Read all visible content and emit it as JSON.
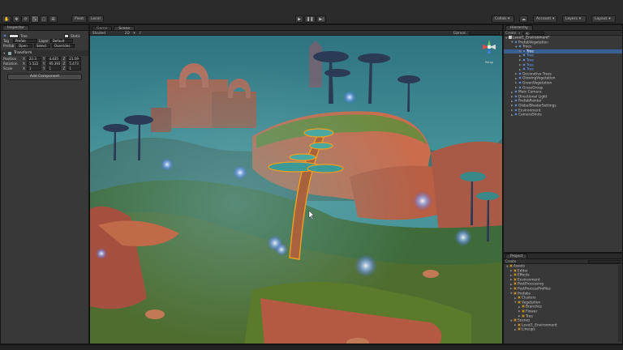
{
  "toolbar": {
    "pivot": "Pivot",
    "local": "Local",
    "collab": "Collab",
    "account": "Account",
    "layers": "Layers",
    "layout": "Layout"
  },
  "inspector": {
    "tab": "Inspector",
    "object_name": "Tree",
    "static": "Static",
    "tag_label": "Tag",
    "tag_value": "Prefab",
    "layer_label": "Layer",
    "layer_value": "Default",
    "prefab_label": "Prefab",
    "prefab_open": "Open",
    "prefab_select": "Select",
    "prefab_overrides": "Overrides",
    "transform_title": "Transform",
    "position_label": "Position",
    "position": {
      "x": "22.3",
      "y": "4.435",
      "z": "21.59"
    },
    "rotation_label": "Rotation",
    "rotation": {
      "x": "1.522",
      "y": "95.393",
      "z": "5.473"
    },
    "scale_label": "Scale",
    "scale": {
      "x": "1",
      "y": "1",
      "z": "1"
    },
    "add_component": "Add Component"
  },
  "scene_view": {
    "tab_game": "Game",
    "tab_scene": "Scene",
    "shaded": "Shaded",
    "mode_2d": "2D",
    "gizmos": "Gizmos",
    "persp": "Persp"
  },
  "hierarchy": {
    "tab": "Hierarchy",
    "create": "Create",
    "search_all": "All",
    "root": "Level1_Environment*",
    "items": [
      {
        "label": "PrefabVegetation",
        "depth": 1,
        "open": true
      },
      {
        "label": "Trees",
        "depth": 2,
        "open": true
      },
      {
        "label": "Tree",
        "depth": 3,
        "selected": true
      },
      {
        "label": "Tree",
        "depth": 3,
        "blue": true
      },
      {
        "label": "Tree",
        "depth": 3,
        "blue": true
      },
      {
        "label": "Tree",
        "depth": 3,
        "blue": true
      },
      {
        "label": "Tree",
        "depth": 3,
        "blue": true
      },
      {
        "label": "Decorative Trees",
        "depth": 2
      },
      {
        "label": "GlowingVegetation",
        "depth": 2
      },
      {
        "label": "GreenVegetation",
        "depth": 2
      },
      {
        "label": "GrassGroup",
        "depth": 2
      },
      {
        "label": "Main Camera",
        "depth": 1
      },
      {
        "label": "Directional Light",
        "depth": 1
      },
      {
        "label": "PrefabPainter",
        "depth": 1
      },
      {
        "label": "GlobalShaderSettings",
        "depth": 1
      },
      {
        "label": "Environment",
        "depth": 1
      },
      {
        "label": "CameraShots",
        "depth": 1
      }
    ]
  },
  "project": {
    "tab": "Project",
    "create": "Create",
    "items": [
      {
        "label": "Assets",
        "depth": 0,
        "open": true
      },
      {
        "label": "Editor",
        "depth": 1
      },
      {
        "label": "Effects",
        "depth": 1
      },
      {
        "label": "Environment",
        "depth": 1
      },
      {
        "label": "PostProcessing",
        "depth": 1
      },
      {
        "label": "PostProcessProfiles",
        "depth": 1
      },
      {
        "label": "Prefabs",
        "depth": 1,
        "open": true
      },
      {
        "label": "Clusters",
        "depth": 2
      },
      {
        "label": "Vegetation",
        "depth": 2,
        "open": true
      },
      {
        "label": "Branches",
        "depth": 3
      },
      {
        "label": "Flower",
        "depth": 3
      },
      {
        "label": "Tree",
        "depth": 3
      },
      {
        "label": "Scenes",
        "depth": 1,
        "open": true
      },
      {
        "label": "Level1_Environment",
        "depth": 2
      },
      {
        "label": "Lineups",
        "depth": 2
      }
    ]
  },
  "colors": {
    "selection": "#3a5f93",
    "tree_outline": "#f0a020",
    "panel": "#383838"
  }
}
